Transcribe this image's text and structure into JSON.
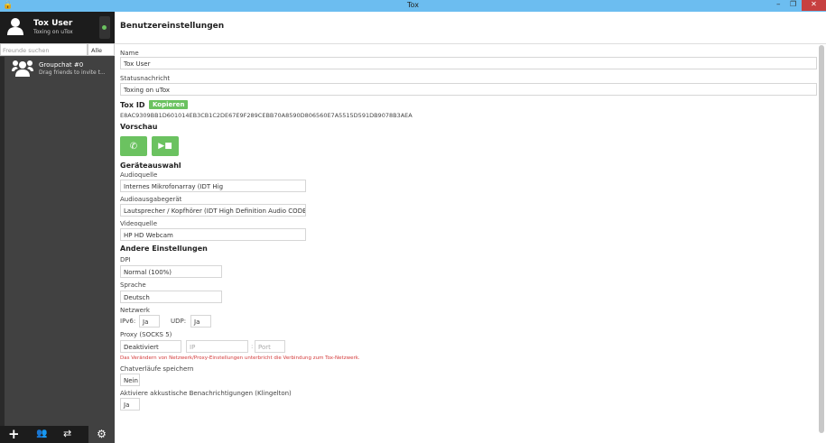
{
  "window": {
    "title": "Tox"
  },
  "user": {
    "name": "Tox User",
    "status": "Toxing on uTox",
    "status_color": "#6bc260"
  },
  "search": {
    "placeholder": "Freunde suchen",
    "filter": "Alle"
  },
  "friends": [
    {
      "name": "Groupchat #0",
      "subtitle": "Drag friends to invite t..."
    }
  ],
  "settings": {
    "title": "Benutzereinstellungen",
    "name_label": "Name",
    "name_value": "Tox User",
    "status_label": "Statusnachricht",
    "status_value": "Toxing on uTox",
    "toxid_label": "Tox ID",
    "copy_label": "Kopieren",
    "toxid": "E8AC9309BB1D601014EB3CB1C2DE67E9F289CEBB70A8590D806560E7A5515D591DB9078B3AEA",
    "preview_label": "Vorschau",
    "devices_label": "Geräteauswahl",
    "audio_in_label": "Audioquelle",
    "audio_in": "Internes Mikrofonarray (IDT Hig",
    "audio_out_label": "Audioausgabegerät",
    "audio_out": "Lautsprecher / Kopfhörer (IDT High Definition Audio CODEC)",
    "video_label": "Videoquelle",
    "video": "HP HD Webcam",
    "other_label": "Andere Einstellungen",
    "dpi_label": "DPI",
    "dpi": "Normal (100%)",
    "lang_label": "Sprache",
    "lang": "Deutsch",
    "network_label": "Netzwerk",
    "ipv6_label": "IPv6:",
    "ipv6": "Ja",
    "udp_label": "UDP:",
    "udp": "Ja",
    "proxy_label": "Proxy (SOCKS 5)",
    "proxy": "Deaktiviert",
    "ip_placeholder": "IP",
    "port_sep": ":",
    "port_placeholder": "Port",
    "warning": "Das Verändern von Netzwerk/Proxy-Einstellungen unterbricht die Verbindung zum Tox-Netzwerk.",
    "history_label": "Chatverläufe speichern",
    "history": "Nein",
    "ring_label": "Aktiviere akkustische Benachrichtigungen (Klingelton)",
    "ring": "Ja"
  },
  "colors": {
    "accent": "#6bc260",
    "warning": "#d43a3a",
    "titlebar": "#6cbdf0"
  }
}
